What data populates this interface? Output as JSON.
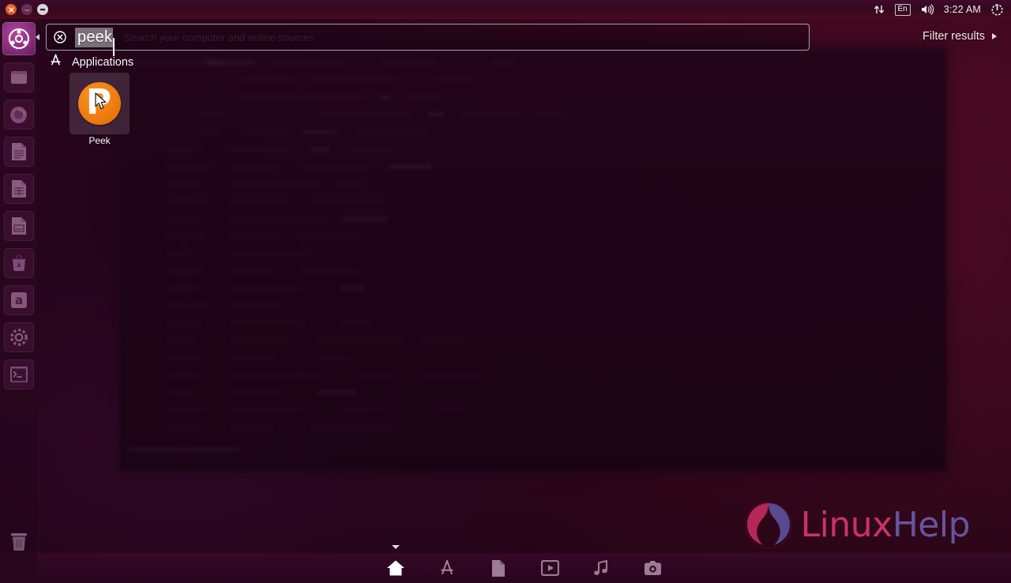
{
  "panel": {
    "window_controls": [
      {
        "name": "close",
        "glyph": "×"
      },
      {
        "name": "minimize",
        "glyph": "–"
      },
      {
        "name": "maximize",
        "glyph": "–"
      }
    ],
    "tray": {
      "network_icon": "network-up-down-icon",
      "keyboard_layout": "En",
      "volume_icon": "volume-icon",
      "clock": "3:22 AM",
      "session_icon": "gear-power-icon"
    }
  },
  "search": {
    "value": "peek",
    "placeholder": "Search your computer and online sources",
    "clear_icon": "clear-circle-x-icon"
  },
  "filter": {
    "label": "Filter results",
    "arrow_icon": "triangle-right-icon"
  },
  "category": {
    "icon": "applications-lens-icon",
    "label": "Applications"
  },
  "results": [
    {
      "label": "Peek",
      "icon_glyph": "P",
      "icon_name": "peek-app-icon"
    }
  ],
  "launcher": {
    "bfb_label": "Ubuntu Dash Home",
    "items": [
      {
        "name": "files",
        "label": "Files"
      },
      {
        "name": "firefox",
        "label": "Firefox Web Browser"
      },
      {
        "name": "writer",
        "label": "LibreOffice Writer"
      },
      {
        "name": "calc",
        "label": "LibreOffice Calc"
      },
      {
        "name": "impress",
        "label": "LibreOffice Impress"
      },
      {
        "name": "software",
        "label": "Ubuntu Software"
      },
      {
        "name": "amazon",
        "label": "Amazon"
      },
      {
        "name": "settings",
        "label": "System Settings"
      },
      {
        "name": "terminal",
        "label": "Terminal"
      }
    ],
    "trash_label": "Trash"
  },
  "dash_bar": {
    "lenses": [
      {
        "name": "home",
        "label": "Home",
        "active": true
      },
      {
        "name": "applications",
        "label": "Applications",
        "active": false
      },
      {
        "name": "files",
        "label": "Files & Folders",
        "active": false
      },
      {
        "name": "video",
        "label": "Videos",
        "active": false
      },
      {
        "name": "music",
        "label": "Music",
        "active": false
      },
      {
        "name": "photos",
        "label": "Photos",
        "active": false
      }
    ]
  },
  "watermark": {
    "part1": "Linux",
    "part2": "Help"
  },
  "colors": {
    "accent_orange": "#ef7d10",
    "dash_purple": "#2d0620",
    "wallpaper_red": "#8e1430",
    "watermark_pink": "#d7376b",
    "watermark_purple": "#6b5ba8"
  }
}
